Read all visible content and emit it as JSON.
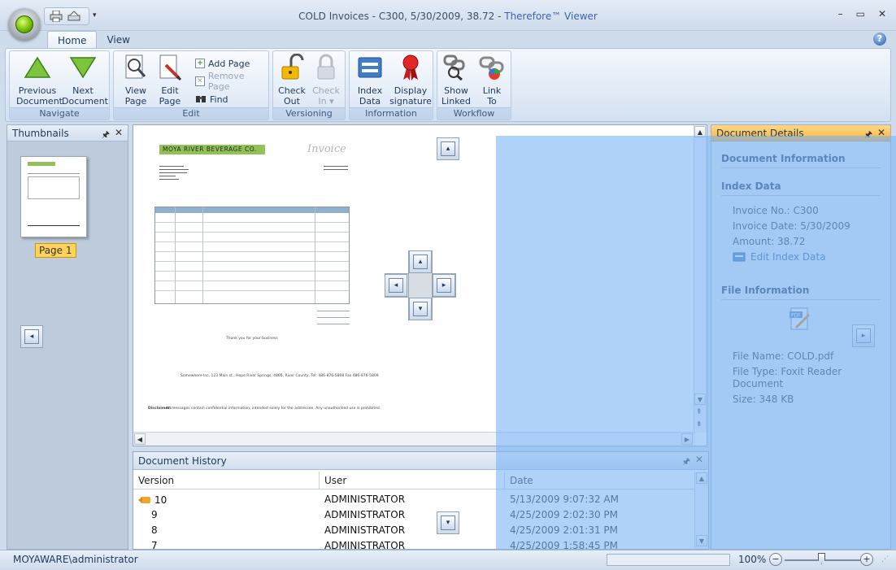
{
  "window": {
    "title": "COLD Invoices - C300, 5/30/2009, 38.72 -",
    "brand": "Therefore™ Viewer",
    "controls": {
      "minimize": "–",
      "maximize": "▭",
      "close": "✕"
    }
  },
  "tabs": [
    {
      "label": "Home",
      "active": true
    },
    {
      "label": "View",
      "active": false
    }
  ],
  "ribbon": {
    "navigate": {
      "label": "Navigate",
      "previous_l1": "Previous",
      "previous_l2": "Document",
      "next_l1": "Next",
      "next_l2": "Document"
    },
    "edit": {
      "label": "Edit",
      "view_l1": "View",
      "view_l2": "Page",
      "edit_l1": "Edit",
      "edit_l2": "Page",
      "add_page": "Add Page",
      "remove_page": "Remove Page",
      "find": "Find"
    },
    "versioning": {
      "label": "Versioning",
      "checkout_l1": "Check",
      "checkout_l2": "Out",
      "checkin_l1": "Check",
      "checkin_l2": "In ▾"
    },
    "information": {
      "label": "Information",
      "index_l1": "Index",
      "index_l2": "Data",
      "sig_l1": "Display",
      "sig_l2": "signature"
    },
    "workflow": {
      "label": "Workflow",
      "linked_l1": "Show",
      "linked_l2": "Linked",
      "link_l1": "Link",
      "link_l2": "To"
    }
  },
  "thumbnails": {
    "title": "Thumbnails",
    "page_label": "Page 1"
  },
  "invoice": {
    "company": "MOYA RIVER BEVERAGE CO.",
    "title": "Invoice",
    "table_rows": 8,
    "thanks": "Thank you for your business",
    "address": "Somewhere Inc, 123 Main st., Hope River Springs, 4865, River County, Tel: 486-876-5808 Fax 486-876-5809",
    "disclaimer_label": "Disclaimer:",
    "disclaimer": "All messages contain confidential information, intended solely for the addressee. Any unauthorised use is prohibited."
  },
  "history": {
    "title": "Document History",
    "columns": [
      "Version",
      "User",
      "Date"
    ],
    "rows": [
      {
        "version": "10",
        "user": "ADMINISTRATOR",
        "date": "5/13/2009 9:07:32 AM",
        "current": true
      },
      {
        "version": "9",
        "user": "ADMINISTRATOR",
        "date": "4/25/2009 2:02:30 PM",
        "current": false
      },
      {
        "version": "8",
        "user": "ADMINISTRATOR",
        "date": "4/25/2009 2:01:31 PM",
        "current": false
      },
      {
        "version": "7",
        "user": "ADMINISTRATOR",
        "date": "4/25/2009 1:58:45 PM",
        "current": false
      }
    ]
  },
  "details": {
    "title": "Document Details",
    "doc_info": "Document Information",
    "index_data": "Index Data",
    "invoice_no": "Invoice No.: C300",
    "invoice_date": "Invoice Date: 5/30/2009",
    "amount": "Amount: 38.72",
    "edit_link": "Edit Index Data",
    "file_info": "File Information",
    "file_name": "File Name: COLD.pdf",
    "file_type_l1": "File Type: Foxit Reader",
    "file_type_l2": "Document",
    "size": "Size: 348 KB"
  },
  "status": {
    "user": "MOYAWARE\\administrator",
    "zoom": "100%"
  },
  "colors": {
    "accent": "#1e395b",
    "overlay": "#7eb6f6",
    "tab_highlight": "#f7b23c"
  }
}
